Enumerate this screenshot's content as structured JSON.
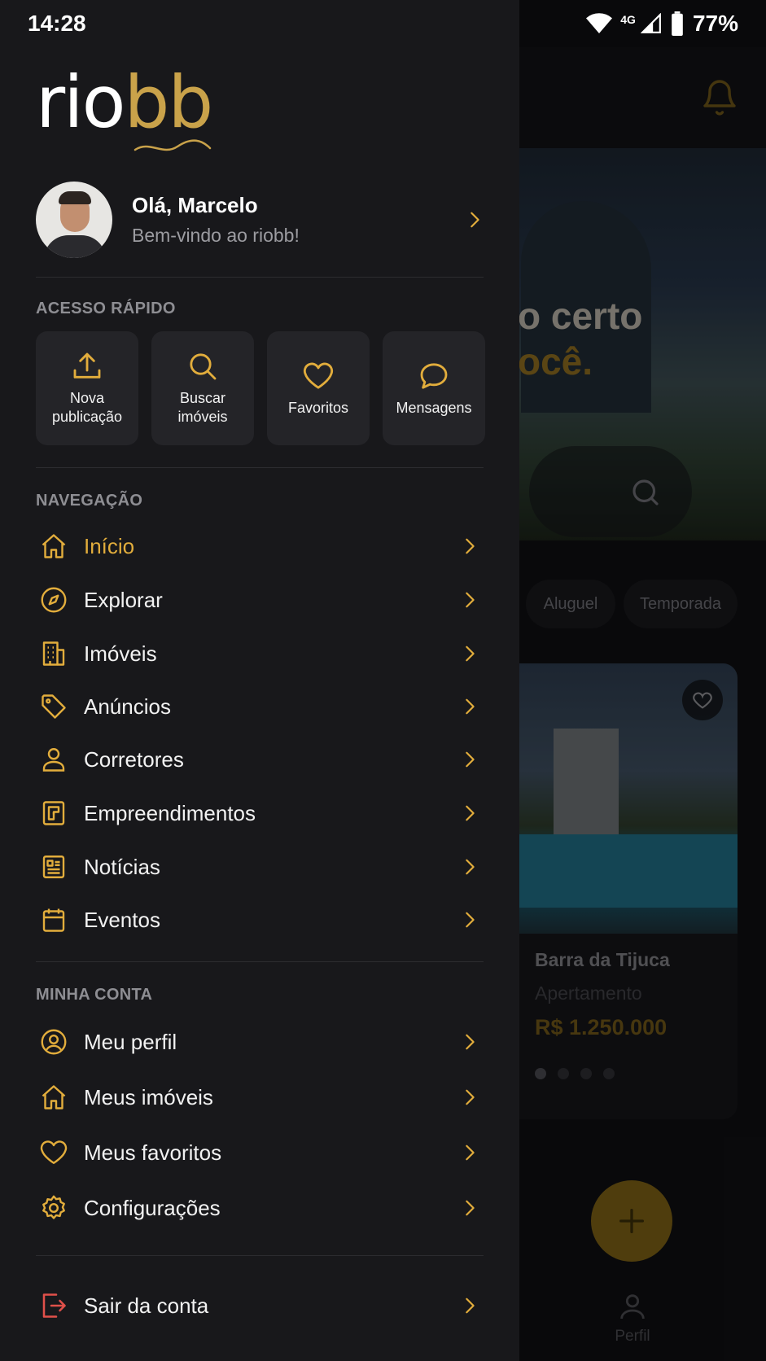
{
  "status_bar": {
    "time": "14:28",
    "network": "4G",
    "battery": "77%"
  },
  "background": {
    "hero_line1": "o certo",
    "hero_line2": "ocê.",
    "chips": [
      "Aluguel",
      "Temporada"
    ],
    "card": {
      "title": "Barra da Tijuca",
      "type": "Apertamento",
      "price": "R$ 1.250.000"
    },
    "profile_label": "Perfil"
  },
  "drawer": {
    "logo": "riobb",
    "user": {
      "greeting": "Olá, Marcelo",
      "subtitle": "Bem-vindo ao riobb!"
    },
    "quick_access": {
      "title": "ACESSO RÁPIDO",
      "items": [
        {
          "label": "Nova\npublicação",
          "icon": "upload-icon"
        },
        {
          "label": "Buscar\nimóveis",
          "icon": "search-icon"
        },
        {
          "label": "Favoritos",
          "icon": "heart-icon"
        },
        {
          "label": "Mensagens",
          "icon": "chat-icon"
        }
      ]
    },
    "navigation": {
      "title": "NAVEGAÇÃO",
      "items": [
        {
          "label": "Início",
          "icon": "home-icon",
          "active": true
        },
        {
          "label": "Explorar",
          "icon": "compass-icon"
        },
        {
          "label": "Imóveis",
          "icon": "building-icon"
        },
        {
          "label": "Anúncios",
          "icon": "tag-icon"
        },
        {
          "label": "Corretores",
          "icon": "person-icon"
        },
        {
          "label": "Empreendimentos",
          "icon": "blueprint-icon"
        },
        {
          "label": "Notícias",
          "icon": "news-icon"
        },
        {
          "label": "Eventos",
          "icon": "calendar-icon"
        }
      ]
    },
    "account": {
      "title": "MINHA CONTA",
      "items": [
        {
          "label": "Meu perfil",
          "icon": "profile-circle-icon"
        },
        {
          "label": "Meus imóveis",
          "icon": "home-icon"
        },
        {
          "label": "Meus favoritos",
          "icon": "heart-icon"
        },
        {
          "label": "Configurações",
          "icon": "gear-icon"
        }
      ]
    },
    "logout": {
      "label": "Sair da conta",
      "icon": "logout-icon"
    }
  },
  "colors": {
    "accent": "#e2ad3c",
    "drawer_bg": "#18181b",
    "card_bg": "#242428",
    "logout": "#e0504a"
  }
}
